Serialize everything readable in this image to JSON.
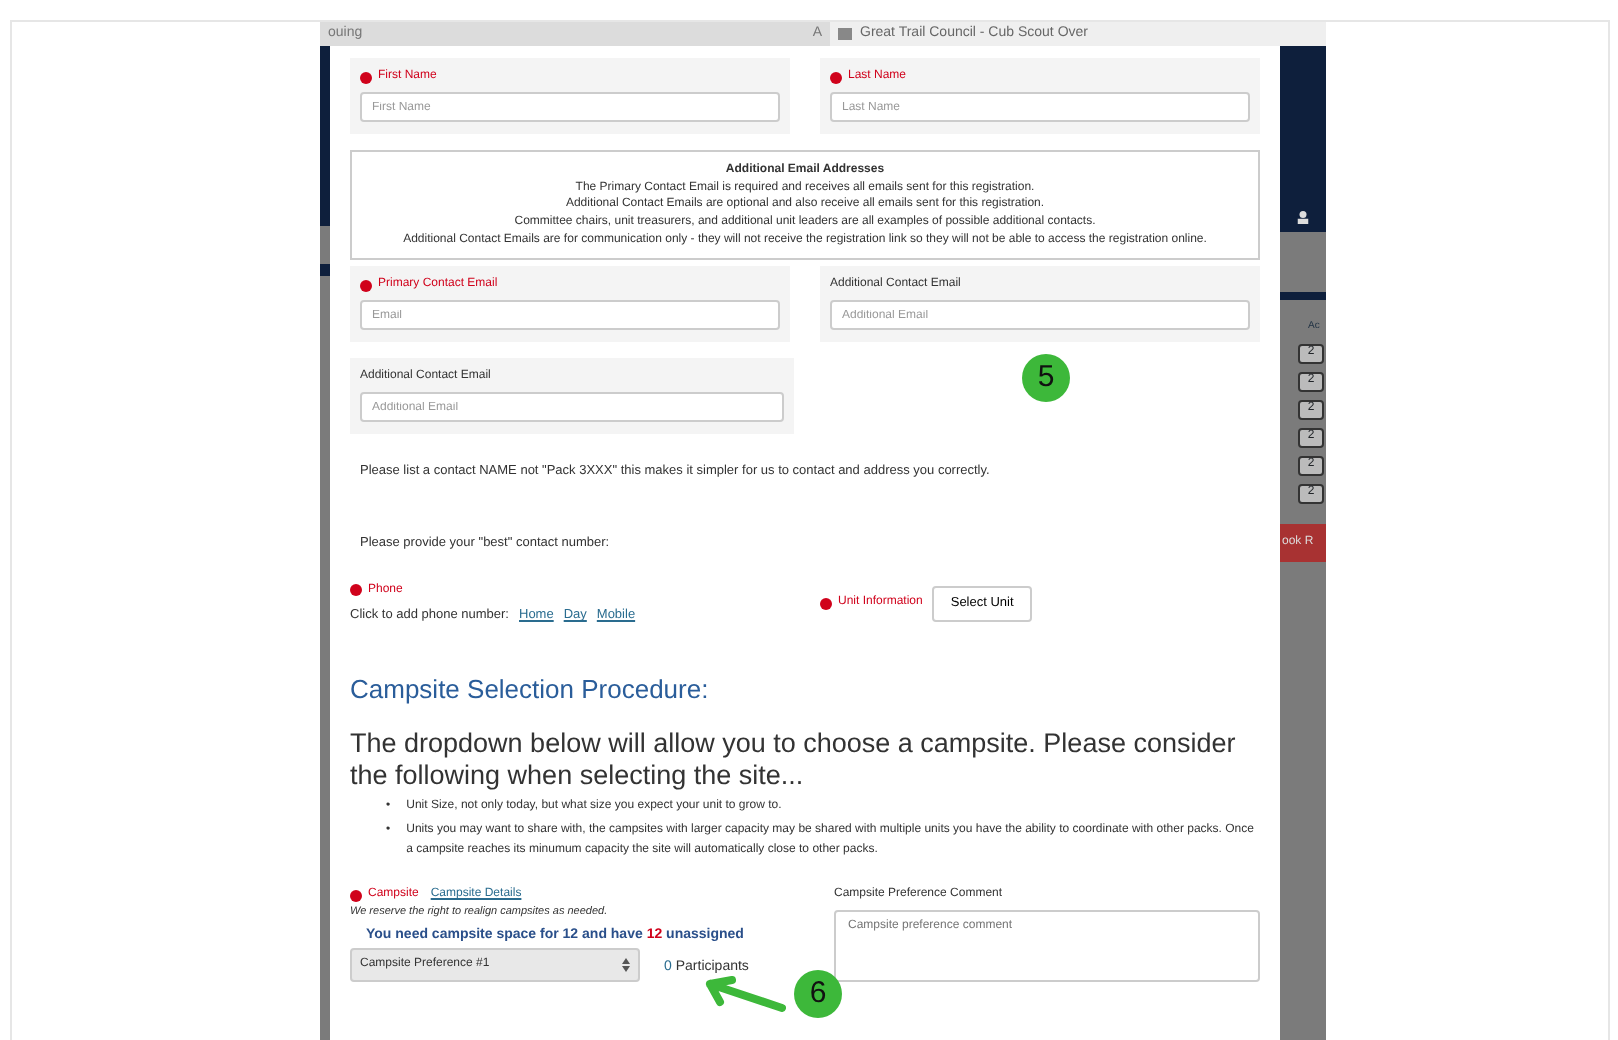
{
  "browser_tabs": [
    {
      "title": "ouing",
      "marker": "A",
      "selected": false
    },
    {
      "title": "Great Trail Council - Cub Scout Over",
      "selected": true
    }
  ],
  "background_page": {
    "column_heading": "Ac",
    "counts": [
      "2",
      "2",
      "2",
      "2",
      "2",
      "2"
    ],
    "button": "ook R"
  },
  "name_fields": [
    {
      "label": "First Name",
      "placeholder": "First Name",
      "required": true
    },
    {
      "label": "Last Name",
      "placeholder": "Last Name",
      "required": true
    }
  ],
  "email_info": {
    "title": "Additional Email Addresses",
    "lines": [
      "The Primary Contact Email is required and receives all emails sent for this registration.",
      "Additional Contact Emails are optional and also receive all emails sent for this registration.",
      "Committee chairs, unit treasurers, and additional unit leaders are all examples of possible additional contacts.",
      "Additional Contact Emails are for communication only - they will not receive the registration link so they will not be able to access the registration online."
    ]
  },
  "email_fields": [
    {
      "label": "Primary Contact Email",
      "placeholder": "Email",
      "required": true
    },
    {
      "label": "Additional Contact Email",
      "placeholder": "Additional Email",
      "required": false
    },
    {
      "label": "Additional Contact Email",
      "placeholder": "Additional Email",
      "required": false
    }
  ],
  "contact_note": "Please list a contact NAME not \"Pack 3XXX\" this makes it simpler for us to contact and address you correctly.",
  "phone_prompt": "Please provide your \"best\" contact number:",
  "phone": {
    "label": "Phone",
    "required": true,
    "prefix": "Click to add phone number:",
    "links": [
      "Home",
      "Day",
      "Mobile"
    ]
  },
  "unit": {
    "label": "Unit Information",
    "required": true,
    "button": "Select Unit"
  },
  "campsite_section": {
    "bullet_marker": "•",
    "heading": "Campsite Selection Procedure:",
    "intro": "The dropdown below will allow you to choose a campsite. Please consider the following when selecting the site...",
    "bullets": [
      "Unit Size, not only today, but what size you expect your unit to grow to.",
      "Units you may want to share with, the campsites with larger capacity may be shared with multiple units you have the ability to coordinate with other packs. Once a campsite reaches its minumum capacity the site will automatically close to other packs."
    ]
  },
  "campsite": {
    "label": "Campsite",
    "required": true,
    "details_link": "Campsite Details",
    "note": "We reserve the right to realign campsites as needed.",
    "need_prefix": "You need campsite space for 12 and have",
    "need_count": "12",
    "need_suffix": "unassigned",
    "select_value": "Campsite Preference #1",
    "participants_count": "0",
    "participants_label": "Participants"
  },
  "comment": {
    "label": "Campsite Preference Comment",
    "placeholder": "Campsite preference comment"
  },
  "annotations": [
    {
      "number": "5",
      "kind": "badge"
    },
    {
      "number": "6",
      "kind": "badge-arrow"
    }
  ]
}
